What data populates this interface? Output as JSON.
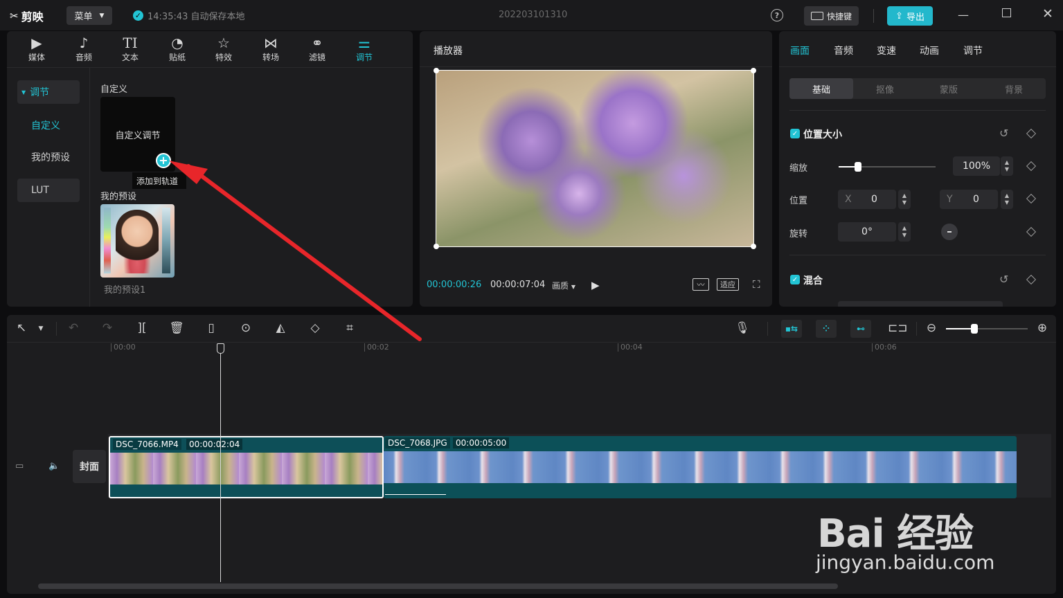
{
  "titlebar": {
    "app_name": "剪映",
    "menu_label": "菜单",
    "save_status": "14:35:43 自动保存本地",
    "project_name": "202203101310",
    "shortcut_label": "快捷键",
    "export_label": "导出"
  },
  "tool_tabs": [
    {
      "label": "媒体",
      "icon": "media-icon"
    },
    {
      "label": "音频",
      "icon": "audio-icon"
    },
    {
      "label": "文本",
      "icon": "text-icon"
    },
    {
      "label": "贴纸",
      "icon": "sticker-icon"
    },
    {
      "label": "特效",
      "icon": "effects-icon"
    },
    {
      "label": "转场",
      "icon": "transition-icon"
    },
    {
      "label": "滤镜",
      "icon": "filter-icon"
    },
    {
      "label": "调节",
      "icon": "adjust-icon"
    }
  ],
  "side_nav": {
    "items": [
      {
        "label": "调节"
      },
      {
        "label": "自定义"
      },
      {
        "label": "我的预设"
      },
      {
        "label": "LUT"
      }
    ]
  },
  "content": {
    "custom_section": "自定义",
    "custom_card_label": "自定义调节",
    "add_to_track_tooltip": "添加到轨道",
    "preset_section": "我的预设",
    "preset_item_label": "我的预设1"
  },
  "player": {
    "title": "播放器",
    "current_time": "00:00:00:26",
    "total_time": "00:00:07:04",
    "quality_label": "画质",
    "fit_label": "适应"
  },
  "inspector": {
    "tabs": [
      "画面",
      "音频",
      "变速",
      "动画",
      "调节"
    ],
    "subtabs": [
      "基础",
      "抠像",
      "蒙版",
      "背景"
    ],
    "position_size_title": "位置大小",
    "scale_label": "缩放",
    "scale_value": "100%",
    "scale_fraction": 0.2,
    "position_label": "位置",
    "x_label": "X",
    "x_value": "0",
    "y_label": "Y",
    "y_value": "0",
    "rotation_label": "旋转",
    "rotation_value": "0°",
    "blend_title": "混合"
  },
  "timeline": {
    "ruler": [
      "00:00",
      "00:02",
      "00:04",
      "00:06"
    ],
    "cover_label": "封面",
    "clips": [
      {
        "name": "DSC_7066.MP4",
        "duration": "00:00:02:04"
      },
      {
        "name": "DSC_7068.JPG",
        "duration": "00:00:05:00"
      }
    ],
    "zoom_fraction": 0.35
  },
  "watermark": {
    "main": "Bai 经验",
    "sub": "jingyan.baidu.com"
  },
  "colors": {
    "accent": "#22c4d4",
    "annotation_arrow": "#e8262a"
  }
}
